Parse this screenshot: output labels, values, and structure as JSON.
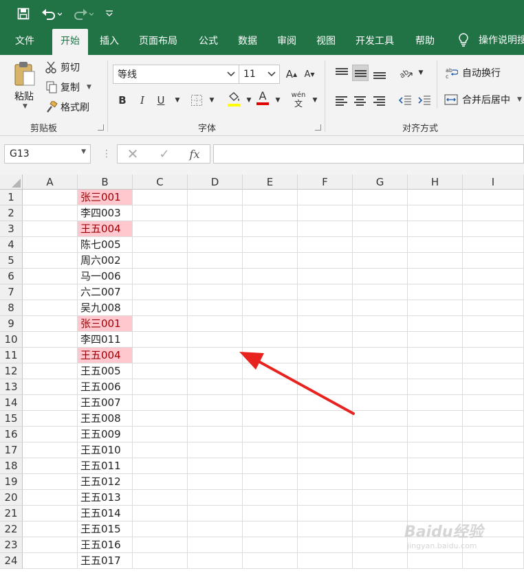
{
  "quick_access": {
    "save_icon": "save-icon",
    "undo_icon": "undo-icon",
    "redo_icon": "redo-icon",
    "customize_icon": "chevron-down-icon"
  },
  "tabs": [
    {
      "label": "文件",
      "active": false
    },
    {
      "label": "开始",
      "active": true
    },
    {
      "label": "插入",
      "active": false
    },
    {
      "label": "页面布局",
      "active": false
    },
    {
      "label": "公式",
      "active": false
    },
    {
      "label": "数据",
      "active": false
    },
    {
      "label": "审阅",
      "active": false
    },
    {
      "label": "视图",
      "active": false
    },
    {
      "label": "开发工具",
      "active": false
    },
    {
      "label": "帮助",
      "active": false
    }
  ],
  "tell_me": {
    "icon": "lightbulb-icon",
    "label": "操作说明搜"
  },
  "ribbon": {
    "clipboard": {
      "paste": "粘贴",
      "cut": "剪切",
      "copy": "复制",
      "format_painter": "格式刷",
      "group": "剪贴板"
    },
    "font": {
      "font_name": "等线",
      "font_size": "11",
      "grow": "A",
      "shrink": "A",
      "bold": "B",
      "italic": "I",
      "underline": "U",
      "font_color": "A",
      "phonetic": "wén\n文",
      "group": "字体"
    },
    "alignment": {
      "wrap_text": "自动换行",
      "merge_center": "合并后居中",
      "group": "对齐方式"
    }
  },
  "formula_bar": {
    "name_box": "G13",
    "fx": "fx",
    "formula": ""
  },
  "columns": [
    "A",
    "B",
    "C",
    "D",
    "E",
    "F",
    "G",
    "H",
    "I"
  ],
  "rows": [
    {
      "n": "1",
      "b": "张三001",
      "dup": true
    },
    {
      "n": "2",
      "b": "李四003",
      "dup": false
    },
    {
      "n": "3",
      "b": "王五004",
      "dup": true
    },
    {
      "n": "4",
      "b": "陈七005",
      "dup": false
    },
    {
      "n": "5",
      "b": "周六002",
      "dup": false
    },
    {
      "n": "6",
      "b": "马一006",
      "dup": false
    },
    {
      "n": "7",
      "b": "六二007",
      "dup": false
    },
    {
      "n": "8",
      "b": "吴九008",
      "dup": false
    },
    {
      "n": "9",
      "b": "张三001",
      "dup": true
    },
    {
      "n": "10",
      "b": "李四011",
      "dup": false
    },
    {
      "n": "11",
      "b": "王五004",
      "dup": true
    },
    {
      "n": "12",
      "b": "王五005",
      "dup": false
    },
    {
      "n": "13",
      "b": "王五006",
      "dup": false
    },
    {
      "n": "14",
      "b": "王五007",
      "dup": false
    },
    {
      "n": "15",
      "b": "王五008",
      "dup": false
    },
    {
      "n": "16",
      "b": "王五009",
      "dup": false
    },
    {
      "n": "17",
      "b": "王五010",
      "dup": false
    },
    {
      "n": "18",
      "b": "王五011",
      "dup": false
    },
    {
      "n": "19",
      "b": "王五012",
      "dup": false
    },
    {
      "n": "20",
      "b": "王五013",
      "dup": false
    },
    {
      "n": "21",
      "b": "王五014",
      "dup": false
    },
    {
      "n": "22",
      "b": "王五015",
      "dup": false
    },
    {
      "n": "23",
      "b": "王五016",
      "dup": false
    },
    {
      "n": "24",
      "b": "王五017",
      "dup": false
    }
  ],
  "colors": {
    "excel_green": "#217346",
    "duplicate_fill": "#ffc7ce",
    "duplicate_text": "#9c0006",
    "annotation_arrow": "#e8231f"
  },
  "watermark": {
    "brand": "Baidu经验",
    "url": "jingyan.baidu.com"
  }
}
